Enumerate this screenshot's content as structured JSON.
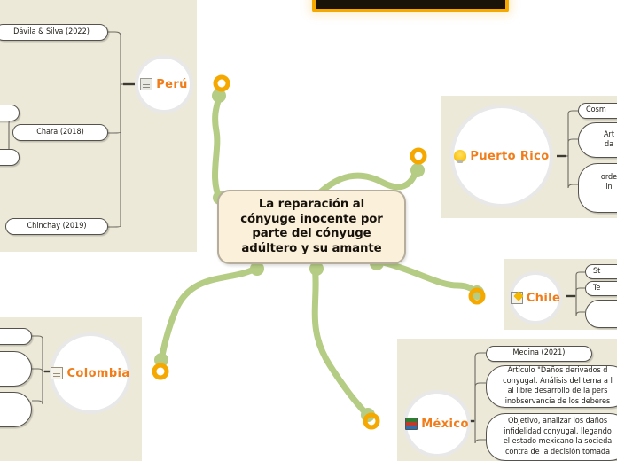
{
  "document": {
    "type": "mind-map",
    "title": "La reparación al cónyuge inocente por parte del cónyuge adúltero y su amante"
  },
  "colors": {
    "panel_beige": "#ece9d8",
    "central_fill": "#fbf0d9",
    "central_border": "#b6ad9c",
    "hub_label": "#f07d1a",
    "connector_green": "#b5cc84",
    "endpoint_orange": "#f5a800",
    "leaf_border": "#55524c",
    "canvas_white": "#ffffff",
    "topbar_dark": "#1a1307"
  },
  "central_node": {
    "name": "central-topic",
    "lines": [
      "La reparación al",
      "cónyuge inocente por",
      "parte del cónyuge",
      "adúltero y su amante"
    ],
    "text": "La reparación al cónyuge inocente por parte del cónyuge adúltero y su amante"
  },
  "top_bar": {
    "name": "top-toolbar-strip",
    "label": ""
  },
  "branches": [
    {
      "id": "peru",
      "label": "Perú",
      "icon": "document-icon",
      "leaves": [
        {
          "text": "Dávila & Silva (2022)",
          "truncated": false
        },
        {
          "text": "Chara (2018)",
          "truncated": false
        },
        {
          "text": "Chinchay (2019)",
          "truncated": false
        }
      ]
    },
    {
      "id": "puerto-rico",
      "label": "Puerto Rico",
      "icon": "lightbulb-icon",
      "leaves": [
        {
          "text": "Cosm",
          "truncated": true
        },
        {
          "text": "Art\nda",
          "truncated": true
        },
        {
          "text": "orde\nin",
          "truncated": true
        }
      ]
    },
    {
      "id": "chile",
      "label": "Chile",
      "icon": "pencil-icon",
      "leaves": [
        {
          "text": "St",
          "truncated": true
        },
        {
          "text": "Te",
          "truncated": true
        },
        {
          "text": "",
          "truncated": true
        }
      ]
    },
    {
      "id": "mexico",
      "label": "México",
      "icon": "books-icon",
      "leaves": [
        {
          "text": "Medina (2021)",
          "truncated": false
        },
        {
          "text": "Artículo \"Daños derivados d\nconyugal. Análisis del tema a l\nal libre desarrollo de la pers\ninobservancia de los deberes",
          "truncated": true
        },
        {
          "text": "Objetivo, analizar los daños\ninfidelidad conyugal, llegando\nel estado mexicano la socieda\ncontra de la decisión tomada",
          "truncated": true
        }
      ]
    },
    {
      "id": "colombia",
      "label": "Colombia",
      "icon": "note-icon",
      "leaves": [
        {
          "text": "",
          "truncated": true
        },
        {
          "text": "",
          "truncated": true
        },
        {
          "text": "",
          "truncated": true
        }
      ]
    }
  ],
  "connectors": [
    {
      "from": "central",
      "to": "peru",
      "endpoint": "ring",
      "color": "#b5cc84"
    },
    {
      "from": "central",
      "to": "puerto-rico",
      "endpoint": "ring",
      "color": "#b5cc84"
    },
    {
      "from": "central",
      "to": "chile",
      "endpoint": "ring",
      "color": "#b5cc84"
    },
    {
      "from": "central",
      "to": "mexico",
      "endpoint": "ring",
      "color": "#b5cc84"
    },
    {
      "from": "central",
      "to": "colombia",
      "endpoint": "ring",
      "color": "#b5cc84"
    }
  ]
}
